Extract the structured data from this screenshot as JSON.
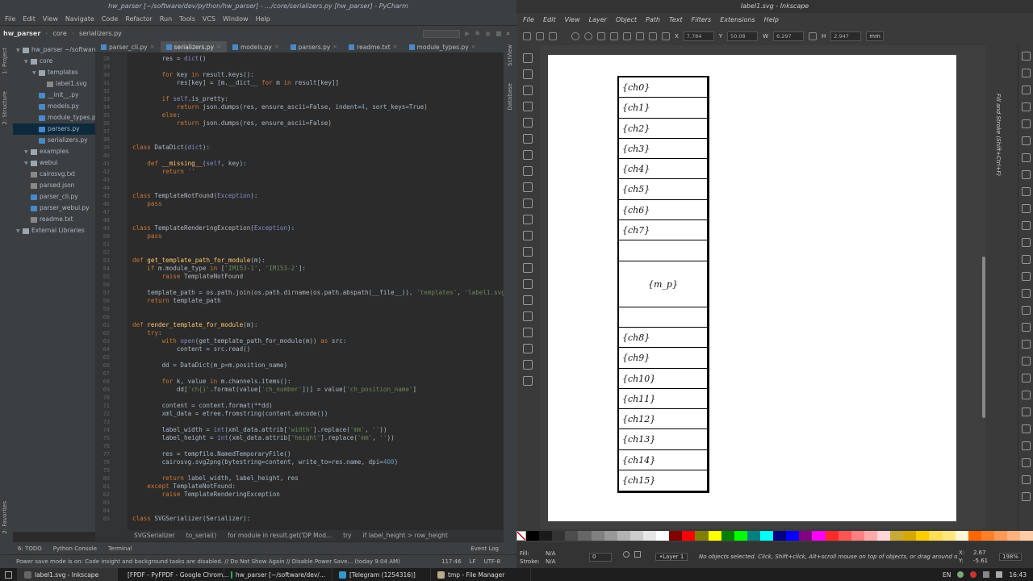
{
  "pycharm": {
    "title": "hw_parser [~/software/dev/python/hw_parser] - .../core/serializers.py [hw_parser] - PyCharm",
    "menu": [
      "File",
      "Edit",
      "View",
      "Navigate",
      "Code",
      "Refactor",
      "Run",
      "Tools",
      "VCS",
      "Window",
      "Help"
    ],
    "nav": [
      "hw_parser",
      "core",
      "serializers.py"
    ],
    "tree": [
      {
        "label": "hw_parser  ~/software/dev/...",
        "indent": 0,
        "kind": "fold"
      },
      {
        "label": "core",
        "indent": 1,
        "kind": "fold"
      },
      {
        "label": "templates",
        "indent": 2,
        "kind": "fold"
      },
      {
        "label": "label1.svg",
        "indent": 3,
        "kind": "txf"
      },
      {
        "label": "__init__.py",
        "indent": 2,
        "kind": "pyf"
      },
      {
        "label": "models.py",
        "indent": 2,
        "kind": "pyf"
      },
      {
        "label": "module_types.py",
        "indent": 2,
        "kind": "pyf"
      },
      {
        "label": "parsers.py",
        "indent": 2,
        "kind": "pyf",
        "selected": true
      },
      {
        "label": "serializers.py",
        "indent": 2,
        "kind": "pyf"
      },
      {
        "label": "examples",
        "indent": 1,
        "kind": "fold"
      },
      {
        "label": "webui",
        "indent": 1,
        "kind": "fold"
      },
      {
        "label": "cairosvg.txt",
        "indent": 1,
        "kind": "txf"
      },
      {
        "label": "parsed.json",
        "indent": 1,
        "kind": "txf"
      },
      {
        "label": "parser_cli.py",
        "indent": 1,
        "kind": "pyf"
      },
      {
        "label": "parser_webui.py",
        "indent": 1,
        "kind": "pyf"
      },
      {
        "label": "readme.txt",
        "indent": 1,
        "kind": "txf"
      },
      {
        "label": "External Libraries",
        "indent": 0,
        "kind": "fold"
      }
    ],
    "tabs": [
      "parser_cli.py",
      "serializers.py",
      "models.py",
      "parsers.py",
      "readme.txt",
      "module_types.py"
    ],
    "active_tab": 1,
    "code_first_line": 28,
    "code": [
      "        res = dict()",
      "",
      "        for key in result.keys():",
      "            res[key] = [m.__dict__ for m in result[key]]",
      "",
      "        if self.is_pretty:",
      "            return json.dumps(res, ensure_ascii=False, indent=4, sort_keys=True)",
      "        else:",
      "            return json.dumps(res, ensure_ascii=False)",
      "",
      "",
      "class DataDict(dict):",
      "",
      "    def __missing__(self, key):",
      "        return ''",
      "",
      "",
      "class TemplateNotFound(Exception):",
      "    pass",
      "",
      "",
      "class TemplateRenderingException(Exception):",
      "    pass",
      "",
      "",
      "def get_template_path_for_module(m):",
      "    if m.module_type in ['IM153-1', 'IM153-2']:",
      "        raise TemplateNotFound",
      "",
      "    template_path = os.path.join(os.path.dirname(os.path.abspath(__file__)), 'templates', 'label1.svg')",
      "    return template_path",
      "",
      "",
      "def render_template_for_module(m):",
      "    try:",
      "        with open(get_template_path_for_module(m)) as src:",
      "            content = src.read()",
      "",
      "        dd = DataDict(m_p=m.position_name)",
      "",
      "        for k, value in m.channels.items():",
      "            dd['ch{}'.format(value['ch_number'])] = value['ch_position_name']",
      "",
      "        content = content.format(**dd)",
      "        xml_data = etree.fromstring(content.encode())",
      "",
      "        label_width = int(xml_data.attrib['width'].replace('mm', ''))",
      "        label_height = int(xml_data.attrib['height'].replace('mm', ''))",
      "",
      "        res = tempfile.NamedTemporaryFile()",
      "        cairosvg.svg2png(bytestring=content, write_to=res.name, dpi=400)",
      "",
      "        return label_width, label_height, res",
      "    except TemplateNotFound:",
      "        raise TemplateRenderingException",
      "",
      "",
      "class SVGSerializer(Serializer):"
    ],
    "breadcrumb": [
      "SVGSerializer",
      "to_serial()",
      "for module in result.get('DP Mod...",
      "try",
      "if label_height > row_height"
    ],
    "toolwindows": [
      "6: TODO",
      "Python Console",
      "Terminal",
      "Event Log"
    ],
    "status_msg": "Power save mode is on: Code insight and background tasks are disabled. // Do Not Show Again // Disable Power Save... (today 9:04 AM)",
    "status_pos": "117:46",
    "status_lf": "LF",
    "status_enc": "UTF-8",
    "left_vtabs": [
      "1: Project",
      "2: Structure",
      "2: Favorites"
    ],
    "right_vtabs": [
      "SciView",
      "Database"
    ]
  },
  "inkscape": {
    "title": "label1.svg - Inkscape",
    "menu": [
      "File",
      "Edit",
      "View",
      "Layer",
      "Object",
      "Path",
      "Text",
      "Filters",
      "Extensions",
      "Help"
    ],
    "x": "7.784",
    "y": "50.08",
    "w": "6.297",
    "h": "2.947",
    "unit": "mm",
    "labels": [
      "{ch0}",
      "{ch1}",
      "{ch2}",
      "{ch3}",
      "{ch4}",
      "{ch5}",
      "{ch6}",
      "{ch7}",
      "",
      "{m_p}",
      "",
      "{ch8}",
      "{ch9}",
      "{ch10}",
      "{ch11}",
      "{ch12}",
      "{ch13}",
      "{ch14}",
      "{ch15}"
    ],
    "panel_title": "Fill and Stroke (Shift+Ctrl+F)",
    "fill_label": "Fill:",
    "fill_val": "N/A",
    "stroke_label": "Stroke:",
    "stroke_val": "N/A",
    "opacity": "0",
    "layer": "•Layer 1",
    "status": "No objects selected. Click, Shift+click, Alt+scroll mouse on top of objects, or drag around obj...",
    "cx_label": "X:",
    "cx": "2.67",
    "cy_label": "Y:",
    "cy": "-5.61",
    "zoom": "198%",
    "palette": [
      "#000000",
      "#1a1a1a",
      "#333333",
      "#4d4d4d",
      "#666666",
      "#808080",
      "#999999",
      "#b3b3b3",
      "#cccccc",
      "#e6e6e6",
      "#ffffff",
      "#800000",
      "#ff0000",
      "#808000",
      "#ffff00",
      "#008000",
      "#00ff00",
      "#008080",
      "#00ffff",
      "#000080",
      "#0000ff",
      "#800080",
      "#ff00ff",
      "#ff2a2a",
      "#ff5555",
      "#ff8080",
      "#ffaaaa",
      "#ffd5d5",
      "#c8ab37",
      "#d4aa00",
      "#ffcc00",
      "#ffdd55",
      "#ffe680",
      "#fff6d5",
      "#ff6600",
      "#ff7f2a",
      "#ff9955",
      "#ffb380",
      "#ffccaa"
    ]
  },
  "taskbar": {
    "tasks": [
      "label1.svg - Inkscape",
      "[FPDF - PyFPDF - Google Chrom...",
      "hw_parser [~/software/dev/...",
      "[Telegram (1254316)]",
      "tmp - File Manager"
    ],
    "lang": "EN",
    "time": "16:43"
  }
}
